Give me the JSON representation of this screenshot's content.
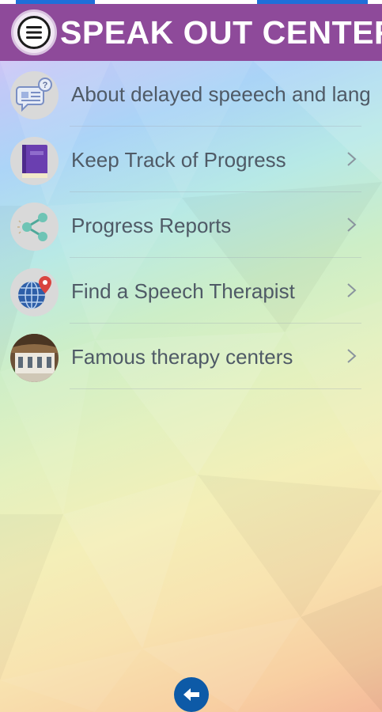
{
  "header": {
    "title": "SPEAK OUT CENTER",
    "menu_icon": "hamburger-menu-icon",
    "bar_color": "#8e4a9a"
  },
  "menu": {
    "items": [
      {
        "label": "About delayed speeech and lang",
        "icon": "speech-bubble-question-icon"
      },
      {
        "label": "Keep Track of Progress",
        "icon": "notebook-icon"
      },
      {
        "label": "Progress Reports",
        "icon": "share-icon"
      },
      {
        "label": "Find a Speech Therapist",
        "icon": "globe-location-pin-icon"
      },
      {
        "label": "Famous therapy centers",
        "icon": "building-photo-icon"
      }
    ]
  },
  "footer": {
    "back_icon": "arrow-left-icon",
    "back_color": "#0d5aa7"
  }
}
